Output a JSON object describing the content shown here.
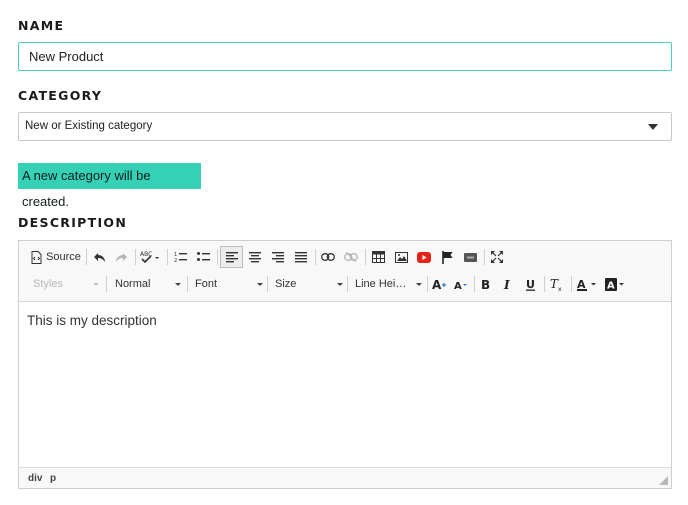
{
  "name_section": {
    "label": "NAME",
    "value": "New Product"
  },
  "category_section": {
    "label": "CATEGORY",
    "selected": "New or Existing category"
  },
  "notice": {
    "text": "A new category will be created."
  },
  "description_section": {
    "label": "DESCRIPTION",
    "toolbar": {
      "source_label": "Source",
      "styles_value": "Styles",
      "format_value": "Normal",
      "font_value": "Font",
      "size_value": "Size",
      "line_height_value": "Line Hei…"
    },
    "content": "This is my description",
    "path": [
      "div",
      "p"
    ]
  },
  "colors": {
    "accent": "#34d1b6",
    "input_focus_border": "#4fd1b8",
    "youtube_red": "#e62117"
  },
  "icons": [
    "source-icon",
    "undo-icon",
    "redo-icon",
    "spellcheck-icon",
    "numbered-list-icon",
    "bulleted-list-icon",
    "align-left-icon",
    "align-center-icon",
    "align-right-icon",
    "justify-icon",
    "link-icon",
    "unlink-icon",
    "table-icon",
    "image-icon",
    "youtube-icon",
    "flag-icon",
    "iframe-icon",
    "maximize-icon",
    "increase-font-icon",
    "decrease-font-icon",
    "bold-icon",
    "italic-icon",
    "underline-icon",
    "remove-format-icon",
    "text-color-icon",
    "background-color-icon",
    "resize-handle-icon"
  ]
}
